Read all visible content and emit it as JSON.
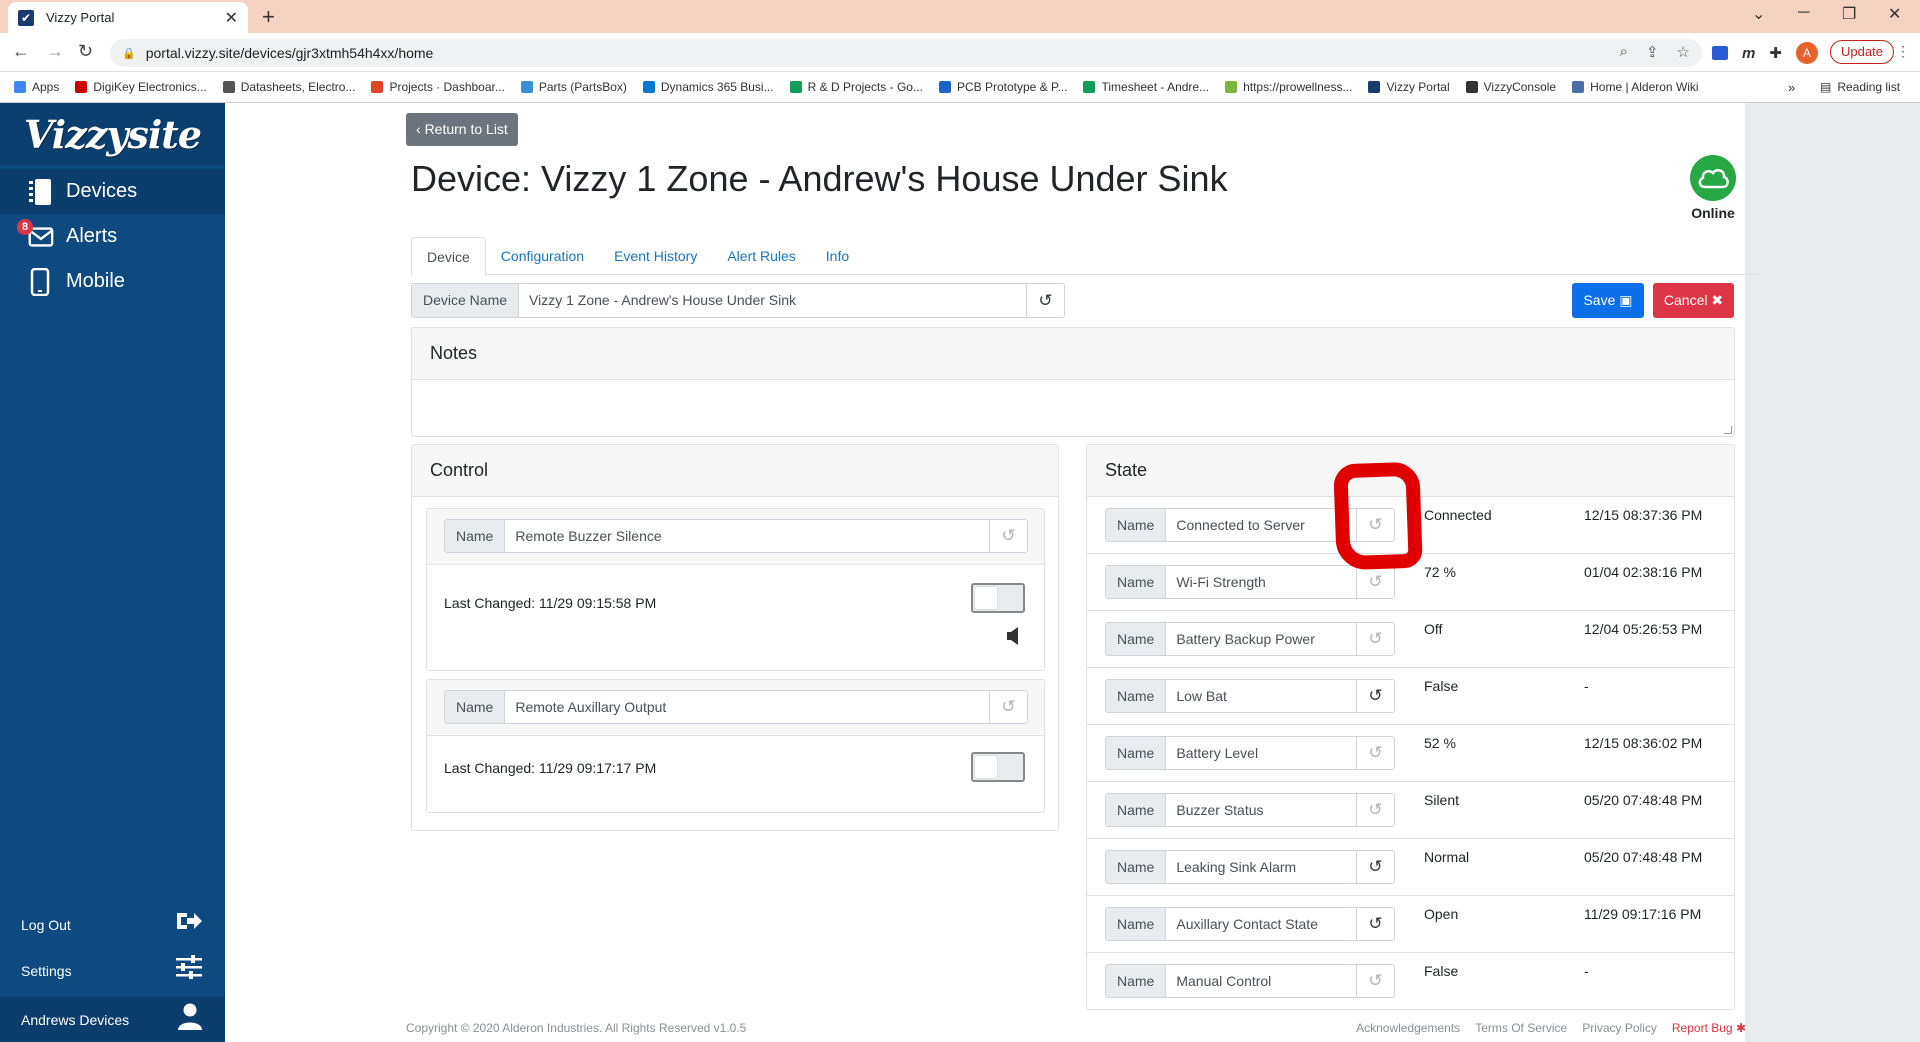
{
  "browser": {
    "tab_title": "Vizzy Portal",
    "url": "portal.vizzy.site/devices/gjr3xtmh54h4xx/home",
    "profile_initial": "A",
    "update_label": "Update",
    "bookmarks": [
      {
        "label": "Apps",
        "color": "#4285f4"
      },
      {
        "label": "DigiKey Electronics...",
        "color": "#cc0000"
      },
      {
        "label": "Datasheets, Electro...",
        "color": "#555555"
      },
      {
        "label": "Projects · Dashboar...",
        "color": "#e24329"
      },
      {
        "label": "Parts (PartsBox)",
        "color": "#3b8ed0"
      },
      {
        "label": "Dynamics 365 Busi...",
        "color": "#0078d4"
      },
      {
        "label": "R & D Projects - Go...",
        "color": "#0f9d58"
      },
      {
        "label": "PCB Prototype & P...",
        "color": "#1e64c8"
      },
      {
        "label": "Timesheet - Andre...",
        "color": "#0f9d58"
      },
      {
        "label": "https://prowellness...",
        "color": "#7cb342"
      },
      {
        "label": "Vizzy Portal",
        "color": "#1a3b6e"
      },
      {
        "label": "VizzyConsole",
        "color": "#333333"
      },
      {
        "label": "Home | Alderon Wiki",
        "color": "#4a6fa5"
      }
    ],
    "reading_list": "Reading list",
    "more": "»"
  },
  "sidebar": {
    "logo": "Vizzysite",
    "items": [
      {
        "label": "Devices",
        "icon": "devices-icon"
      },
      {
        "label": "Alerts",
        "icon": "alerts-icon",
        "badge": "8"
      },
      {
        "label": "Mobile",
        "icon": "mobile-icon"
      }
    ],
    "logout": "Log Out",
    "settings": "Settings",
    "user": "Andrews Devices"
  },
  "page": {
    "return_label": "Return to List",
    "title": "Device: Vizzy 1 Zone - Andrew's House Under Sink",
    "status": "Online",
    "status_color": "#28a745",
    "tabs": [
      "Device",
      "Configuration",
      "Event History",
      "Alert Rules",
      "Info"
    ],
    "device_name_label": "Device Name",
    "device_name_value": "Vizzy 1 Zone - Andrew's House Under Sink",
    "save_label": "Save",
    "cancel_label": "Cancel",
    "notes_title": "Notes"
  },
  "control": {
    "title": "Control",
    "items": [
      {
        "name_label": "Name",
        "name": "Remote Buzzer Silence",
        "last_changed": "Last Changed: 11/29 09:15:58 PM"
      },
      {
        "name_label": "Name",
        "name": "Remote Auxillary Output",
        "last_changed": "Last Changed: 11/29 09:17:17 PM"
      }
    ]
  },
  "state": {
    "title": "State",
    "rows": [
      {
        "name_label": "Name",
        "name": "Connected to Server",
        "value": "Connected",
        "time": "12/15 08:37:36 PM"
      },
      {
        "name_label": "Name",
        "name": "Wi-Fi Strength",
        "value": "72 %",
        "time": "01/04 02:38:16 PM"
      },
      {
        "name_label": "Name",
        "name": "Battery Backup Power",
        "value": "Off",
        "time": "12/04 05:26:53 PM"
      },
      {
        "name_label": "Name",
        "name": "Low Bat",
        "value": "False",
        "time": "-"
      },
      {
        "name_label": "Name",
        "name": "Battery Level",
        "value": "52 %",
        "time": "12/15 08:36:02 PM"
      },
      {
        "name_label": "Name",
        "name": "Buzzer Status",
        "value": "Silent",
        "time": "05/20 07:48:48 PM"
      },
      {
        "name_label": "Name",
        "name": "Leaking Sink Alarm",
        "value": "Normal",
        "time": "05/20 07:48:48 PM"
      },
      {
        "name_label": "Name",
        "name": "Auxillary Contact State",
        "value": "Open",
        "time": "11/29 09:17:16 PM"
      },
      {
        "name_label": "Name",
        "name": "Manual Control",
        "value": "False",
        "time": "-"
      }
    ]
  },
  "footer": {
    "copyright": "Copyright © 2020 Alderon Industries. All Rights Reserved    v1.0.5",
    "links": [
      "Acknowledgements",
      "Terms Of Service",
      "Privacy Policy",
      "Report Bug"
    ]
  }
}
